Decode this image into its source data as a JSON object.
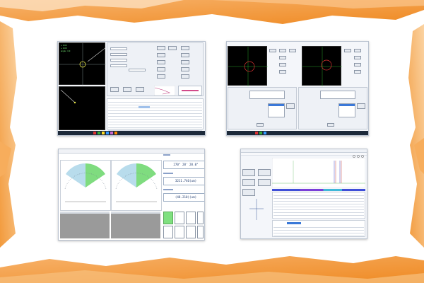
{
  "page": {
    "background_accent": "#f39c33",
    "background_base": "#ffffff"
  },
  "shot1": {
    "overlay_text": [
      "+ 0.00",
      "+ 0.00",
      "angle : 0.0"
    ]
  },
  "shot3": {
    "readouts": [
      {
        "value": "270° 28' 28.0\""
      },
      {
        "value": "3211.746(um)"
      },
      {
        "value": "(48.210)(um)"
      }
    ]
  }
}
